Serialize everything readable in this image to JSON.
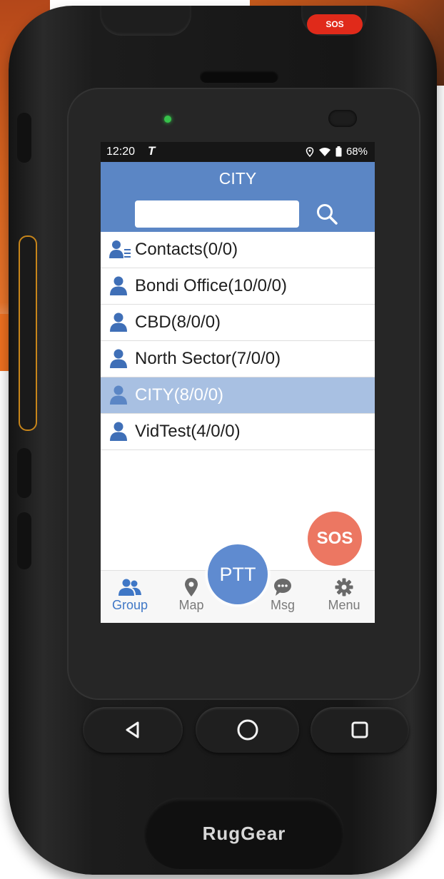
{
  "status": {
    "time": "12:20",
    "carrier": "T",
    "battery": "68%"
  },
  "header": {
    "title": "CITY",
    "search_placeholder": ""
  },
  "groups": [
    {
      "label": "Contacts(0/0)",
      "selected": false,
      "icon": "contacts-icon"
    },
    {
      "label": "Bondi Office(10/0/0)",
      "selected": false,
      "icon": "group-user-icon"
    },
    {
      "label": "CBD(8/0/0)",
      "selected": false,
      "icon": "group-user-icon"
    },
    {
      "label": "North Sector(7/0/0)",
      "selected": false,
      "icon": "group-user-icon"
    },
    {
      "label": "CITY(8/0/0)",
      "selected": true,
      "icon": "group-user-icon"
    },
    {
      "label": "VidTest(4/0/0)",
      "selected": false,
      "icon": "group-user-icon"
    }
  ],
  "sos_label": "SOS",
  "ptt_label": "PTT",
  "tabs": [
    {
      "label": "Group",
      "icon": "group-icon",
      "active": true
    },
    {
      "label": "Map",
      "icon": "map-pin-icon",
      "active": false
    },
    {
      "label": "Msg",
      "icon": "chat-icon",
      "active": false
    },
    {
      "label": "Menu",
      "icon": "gear-icon",
      "active": false
    }
  ],
  "hardware": {
    "sos_button": "SOS",
    "brand": "RugGear"
  },
  "colors": {
    "header": "#5b86c5",
    "selected_row": "#a8c0e2",
    "sos": "#ec7762",
    "ptt": "#5f8bd0",
    "active_tab": "#3f77c6",
    "accent_orange": "#ef7020"
  }
}
